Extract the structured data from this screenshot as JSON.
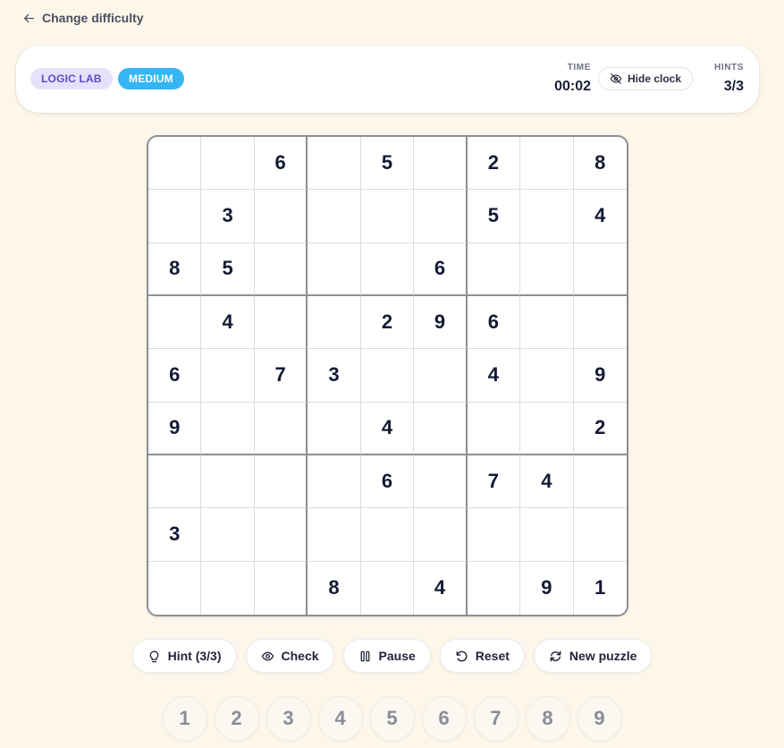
{
  "nav": {
    "back_label": "Change difficulty"
  },
  "header": {
    "badge_lab": "LOGIC LAB",
    "badge_difficulty": "MEDIUM",
    "time_label": "TIME",
    "time_value": "00:02",
    "hide_clock_label": "Hide clock",
    "hints_label": "HINTS",
    "hints_value": "3/3"
  },
  "board": [
    [
      "",
      "",
      "6",
      "",
      "5",
      "",
      "2",
      "",
      "8"
    ],
    [
      "",
      "3",
      "",
      "",
      "",
      "",
      "5",
      "",
      "4"
    ],
    [
      "8",
      "5",
      "",
      "",
      "",
      "6",
      "",
      "",
      ""
    ],
    [
      "",
      "4",
      "",
      "",
      "2",
      "9",
      "6",
      "",
      ""
    ],
    [
      "6",
      "",
      "7",
      "3",
      "",
      "",
      "4",
      "",
      "9"
    ],
    [
      "9",
      "",
      "",
      "",
      "4",
      "",
      "",
      "",
      "2"
    ],
    [
      "",
      "",
      "",
      "",
      "6",
      "",
      "7",
      "4",
      ""
    ],
    [
      "3",
      "",
      "",
      "",
      "",
      "",
      "",
      "",
      ""
    ],
    [
      "",
      "",
      "",
      "8",
      "",
      "4",
      "",
      "9",
      "1"
    ]
  ],
  "controls": {
    "hint_label": "Hint (3/3)",
    "check_label": "Check",
    "pause_label": "Pause",
    "reset_label": "Reset",
    "new_puzzle_label": "New puzzle"
  },
  "numpad": [
    "1",
    "2",
    "3",
    "4",
    "5",
    "6",
    "7",
    "8",
    "9"
  ],
  "colors": {
    "background": "#fdf6ea",
    "badge_lab_bg": "#e6e1fb",
    "badge_lab_text": "#5b4cc4",
    "badge_difficulty_bg": "#35b6f3",
    "digit": "#141a33"
  }
}
